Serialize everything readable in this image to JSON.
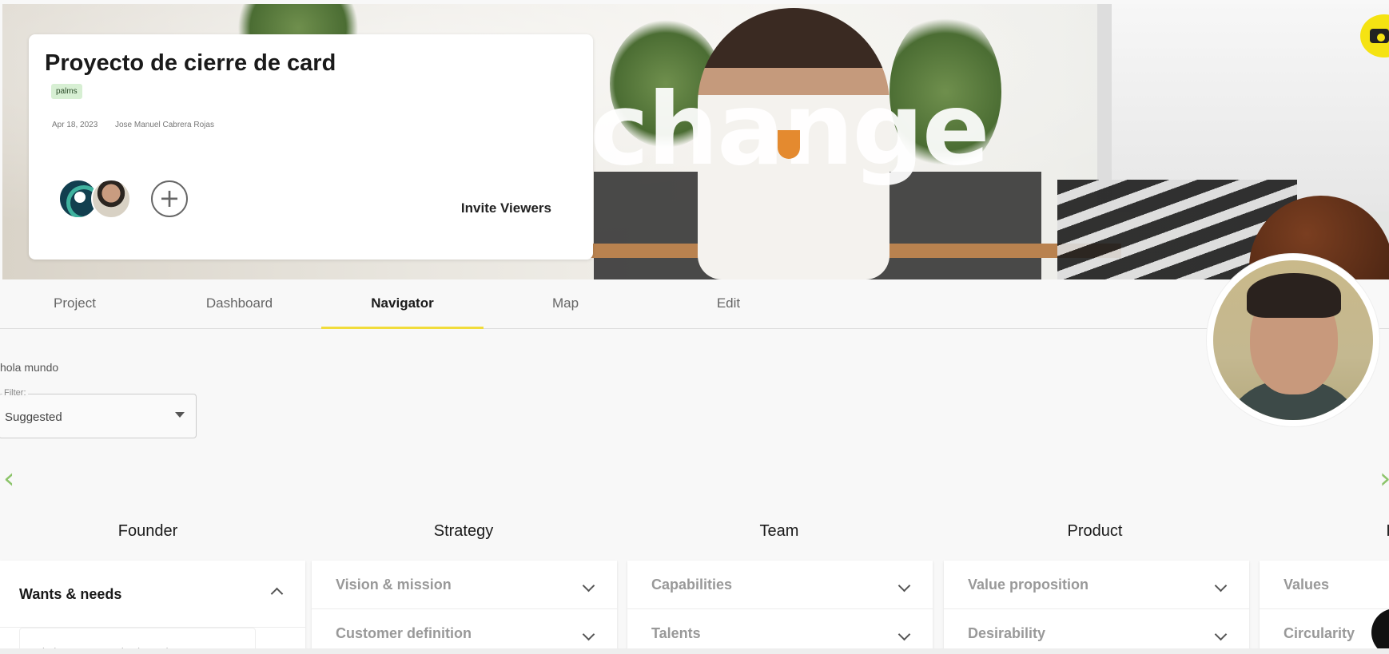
{
  "hero": {
    "banner_word": "change",
    "camera_icon": "camera-icon"
  },
  "card": {
    "title": "Proyecto de cierre de card",
    "tag": "palms",
    "date": "Apr 18, 2023",
    "author": "Jose Manuel Cabrera Rojas",
    "add_icon": "plus-circle-icon",
    "add_symbol": "+",
    "invite_label": "Invite Viewers"
  },
  "tabs": [
    {
      "label": "Project"
    },
    {
      "label": "Dashboard"
    },
    {
      "label": "Navigator"
    },
    {
      "label": "Map"
    },
    {
      "label": "Edit"
    }
  ],
  "active_tab": "Navigator",
  "greeting": "hola mundo",
  "filter": {
    "legend": "Filter:",
    "value": "Suggested"
  },
  "arrows": {
    "prev": "‹",
    "next": "›"
  },
  "columns": [
    {
      "title": "Founder",
      "items": [
        "Wants & needs"
      ],
      "inner_text": "Find your own motivation to l"
    },
    {
      "title": "Strategy",
      "items": [
        "Vision & mission",
        "Customer definition"
      ]
    },
    {
      "title": "Team",
      "items": [
        "Capabilities",
        "Talents"
      ]
    },
    {
      "title": "Product",
      "items": [
        "Value proposition",
        "Desirability"
      ]
    },
    {
      "title": "I",
      "items": [
        "Values",
        "Circularity"
      ]
    }
  ],
  "colors": {
    "accent_yellow": "#f1dc3b",
    "tag_green": "#d7efd3",
    "arrow_green": "#8cc46a"
  }
}
